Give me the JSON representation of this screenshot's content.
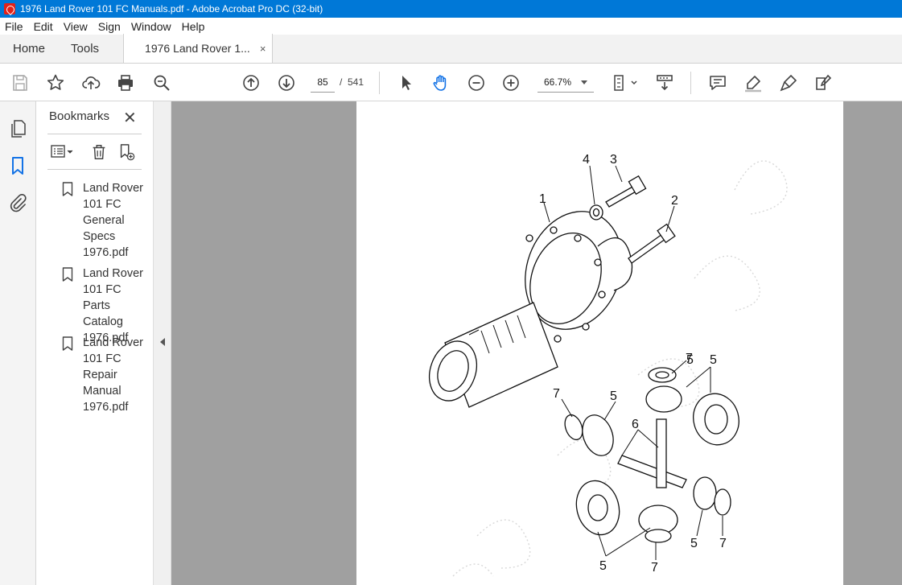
{
  "window": {
    "title": "1976 Land Rover 101 FC Manuals.pdf - Adobe Acrobat Pro DC (32-bit)"
  },
  "menu": [
    "File",
    "Edit",
    "View",
    "Sign",
    "Window",
    "Help"
  ],
  "tabs": {
    "home": "Home",
    "tools": "Tools",
    "document": "1976 Land Rover 1...",
    "close": "×"
  },
  "toolbar": {
    "page_current": "85",
    "page_separator": "/",
    "page_total": "541",
    "zoom": "66.7%"
  },
  "bookmarks": {
    "title": "Bookmarks",
    "close": "✕",
    "items": [
      {
        "lines": [
          "Land Rover",
          "101 FC",
          "General",
          "Specs",
          "1976.pdf"
        ]
      },
      {
        "lines": [
          "Land Rover",
          "101 FC Parts",
          "Catalog",
          "1976.pdf"
        ]
      },
      {
        "lines": [
          "Land Rover",
          "101 FC",
          "Repair",
          "Manual",
          "1976.pdf"
        ]
      }
    ]
  },
  "diagram": {
    "callouts": [
      "1",
      "2",
      "3",
      "4",
      "5",
      "5",
      "5",
      "5",
      "5",
      "6",
      "7",
      "7",
      "7",
      "7"
    ]
  }
}
